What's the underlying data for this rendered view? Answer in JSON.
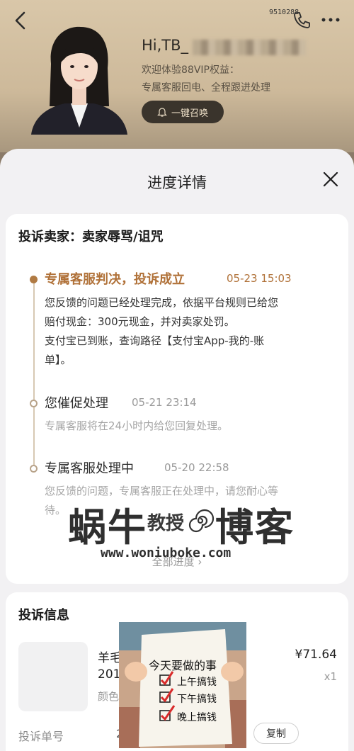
{
  "header": {
    "back_icon": "chevron-left-icon",
    "phone_number": "9510288",
    "phone_icon": "phone-icon",
    "more_icon": "more-horizontal-icon",
    "greeting": "Hi,TB_",
    "welcome": "欢迎体验88VIP权益：",
    "service_desc": "专属客服回电、全程跟进处理",
    "summon_button": "一键召唤",
    "bell_icon": "bell-icon"
  },
  "sheet": {
    "title": "进度详情",
    "close_icon": "close-icon"
  },
  "progress": {
    "complaint_title": "投诉卖家：卖家辱骂/诅咒",
    "steps": [
      {
        "title": "专属客服判决，投诉成立",
        "time": "05-23 15:03",
        "lines": [
          "您反馈的问题已经处理完成，依据平台规则已给您",
          "赔付现金：300元现金，并对卖家处罚。",
          "支付宝已到账，查询路径【支付宝App-我的-账",
          "单】。"
        ],
        "active": true
      },
      {
        "title": "您催促处理",
        "time": "05-21 23:14",
        "lines": [
          "专属客服将在24小时内给您回复处理。"
        ],
        "active": false
      },
      {
        "title": "专属客服处理中",
        "time": "05-20 22:58",
        "lines": [
          "您反馈的问题，专属客服正在处理中，请您耐心等",
          "待。"
        ],
        "active": false
      }
    ],
    "all_progress_link": "全部进度",
    "watermark_brand": "蜗牛",
    "watermark_sub": "教授",
    "watermark_blog": "博客",
    "watermark_url": "www.woniuboke.com"
  },
  "complaint_info": {
    "title": "投诉信息",
    "product_line1": "羊毛",
    "product_line2": "201",
    "product_spec": "颜色",
    "price": "¥71.64",
    "quantity": "x1",
    "order_label": "投诉单号",
    "order_value": "2",
    "copy_button": "复制"
  },
  "overlay_meme": {
    "title": "今天要做的事",
    "items": [
      "上午搞钱",
      "下午搞钱",
      "晚上搞钱"
    ]
  },
  "colors": {
    "accent": "#b07138",
    "sheet_bg": "#f2f1f3",
    "header_gold": "#d9c7a9"
  }
}
